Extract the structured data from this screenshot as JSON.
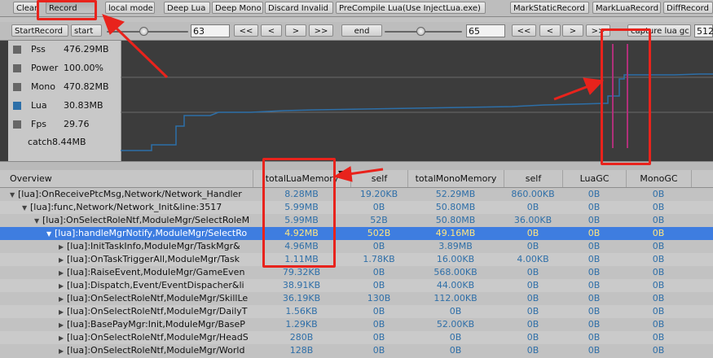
{
  "toolbar1": {
    "buttons": [
      "Clear",
      "Record",
      "local mode",
      "Deep Lua",
      "Deep Mono",
      "Discard Invalid",
      "PreCompile Lua(Use InjectLua.exe)",
      "MarkStaticRecord",
      "MarkLuaRecord",
      "DiffRecord"
    ]
  },
  "toolbar2": {
    "start_record": "StartRecord",
    "start_label": "start",
    "start_value": "63",
    "prev_prev": "<<",
    "prev": "<",
    "next": ">",
    "next_next": ">>",
    "end_label": "end",
    "end_value": "65",
    "capture_label": "capture lua gc",
    "right_number": "512"
  },
  "legend": [
    {
      "name": "Pss",
      "value": "476.29MB",
      "color": "#6a6a6a"
    },
    {
      "name": "Power",
      "value": "100.00%",
      "color": "#6a6a6a"
    },
    {
      "name": "Mono",
      "value": "470.82MB",
      "color": "#6a6a6a"
    },
    {
      "name": "Lua",
      "value": "30.83MB",
      "color": "#2d6fa8"
    },
    {
      "name": "Fps",
      "value": "29.76",
      "color": "#6a6a6a"
    }
  ],
  "legend_extra": {
    "name": "catch",
    "value": "8.44MB"
  },
  "table": {
    "headers": [
      "Overview",
      "totalLuaMemory",
      "self",
      "totalMonoMemory",
      "self",
      "LuaGC",
      "MonoGC"
    ],
    "rows": [
      {
        "expanded": true,
        "name": "[lua]:OnReceivePtcMsg,Network/Network_Handler",
        "c": [
          "8.28MB",
          "19.20KB",
          "52.29MB",
          "860.00KB",
          "0B",
          "0B"
        ]
      },
      {
        "expanded": true,
        "name": "[lua]:func,Network/Network_Init&line:3517",
        "c": [
          "5.99MB",
          "0B",
          "50.80MB",
          "0B",
          "0B",
          "0B"
        ]
      },
      {
        "expanded": true,
        "name": "[lua]:OnSelectRoleNtf,ModuleMgr/SelectRoleM",
        "c": [
          "5.99MB",
          "52B",
          "50.80MB",
          "36.00KB",
          "0B",
          "0B"
        ]
      },
      {
        "expanded": true,
        "name": "[lua]:handleMgrNotify,ModuleMgr/SelectRo",
        "c": [
          "4.92MB",
          "502B",
          "49.16MB",
          "0B",
          "0B",
          "0B"
        ]
      },
      {
        "expanded": false,
        "name": "[lua]:InitTaskInfo,ModuleMgr/TaskMgr&",
        "c": [
          "4.96MB",
          "0B",
          "3.89MB",
          "0B",
          "0B",
          "0B"
        ]
      },
      {
        "expanded": false,
        "name": "[lua]:OnTaskTriggerAll,ModuleMgr/Task",
        "c": [
          "1.11MB",
          "1.78KB",
          "16.00KB",
          "4.00KB",
          "0B",
          "0B"
        ]
      },
      {
        "expanded": false,
        "name": "[lua]:RaiseEvent,ModuleMgr/GameEven",
        "c": [
          "79.32KB",
          "0B",
          "568.00KB",
          "0B",
          "0B",
          "0B"
        ]
      },
      {
        "expanded": false,
        "name": "[lua]:Dispatch,Event/EventDispacher&li",
        "c": [
          "38.91KB",
          "0B",
          "44.00KB",
          "0B",
          "0B",
          "0B"
        ]
      },
      {
        "expanded": false,
        "name": "[lua]:OnSelectRoleNtf,ModuleMgr/SkillLe",
        "c": [
          "36.19KB",
          "130B",
          "112.00KB",
          "0B",
          "0B",
          "0B"
        ]
      },
      {
        "expanded": false,
        "name": "[lua]:OnSelectRoleNtf,ModuleMgr/DailyT",
        "c": [
          "1.56KB",
          "0B",
          "0B",
          "0B",
          "0B",
          "0B"
        ]
      },
      {
        "expanded": false,
        "name": "[lua]:BasePayMgr:Init,ModuleMgr/BaseP",
        "c": [
          "1.29KB",
          "0B",
          "52.00KB",
          "0B",
          "0B",
          "0B"
        ]
      },
      {
        "expanded": false,
        "name": "[lua]:OnSelectRoleNtf,ModuleMgr/HeadS",
        "c": [
          "280B",
          "0B",
          "0B",
          "0B",
          "0B",
          "0B"
        ]
      },
      {
        "expanded": false,
        "name": "[lua]:OnSelectRoleNtf,ModuleMgr/World",
        "c": [
          "128B",
          "0B",
          "0B",
          "0B",
          "0B",
          "0B"
        ]
      }
    ]
  },
  "colors": {
    "selected_row": "#3e7de0",
    "graph_bg": "#3c3c3c",
    "lua_line": "#2d6fa8",
    "marker_line": "#b0307a",
    "annotation": "#e8231c"
  }
}
